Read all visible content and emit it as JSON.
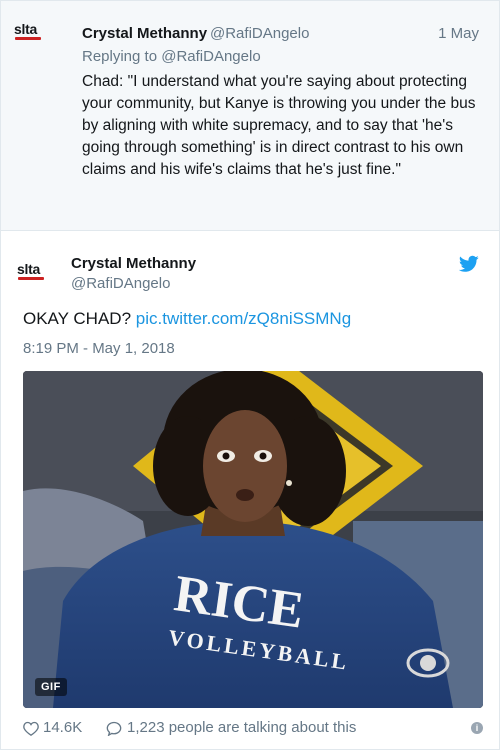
{
  "parent_tweet": {
    "name": "Crystal Methanny",
    "handle": "@RafiDAngelo",
    "date": "1 May",
    "reply_prefix": "Replying to",
    "reply_handle": "@RafiDAngelo",
    "text": "Chad: \"I understand what you're saying about protecting your community, but Kanye is throwing you under the bus by aligning with white supremacy, and to say that 'he's going through something' is in direct contrast to his own claims and his wife's claims that he's just fine.\"",
    "avatar_text": "slta"
  },
  "main_tweet": {
    "name": "Crystal Methanny",
    "handle": "@RafiDAngelo",
    "avatar_text": "slta",
    "text": "OKAY CHAD?",
    "link": "pic.twitter.com/zQ8niSSMNg",
    "timestamp": "8:19 PM - May 1, 2018",
    "media": {
      "badge": "GIF",
      "shirt_line1": "RICE",
      "shirt_line2": "VOLLEYBALL"
    },
    "footer": {
      "likes": "14.6K",
      "talking": "1,223 people are talking about this",
      "info_glyph": "i"
    }
  },
  "colors": {
    "link_blue": "#1b95e0",
    "twitter_blue": "#1da1f2",
    "muted": "#657786",
    "parent_bg": "#f5f8fa",
    "logo_red": "#cc2222"
  }
}
